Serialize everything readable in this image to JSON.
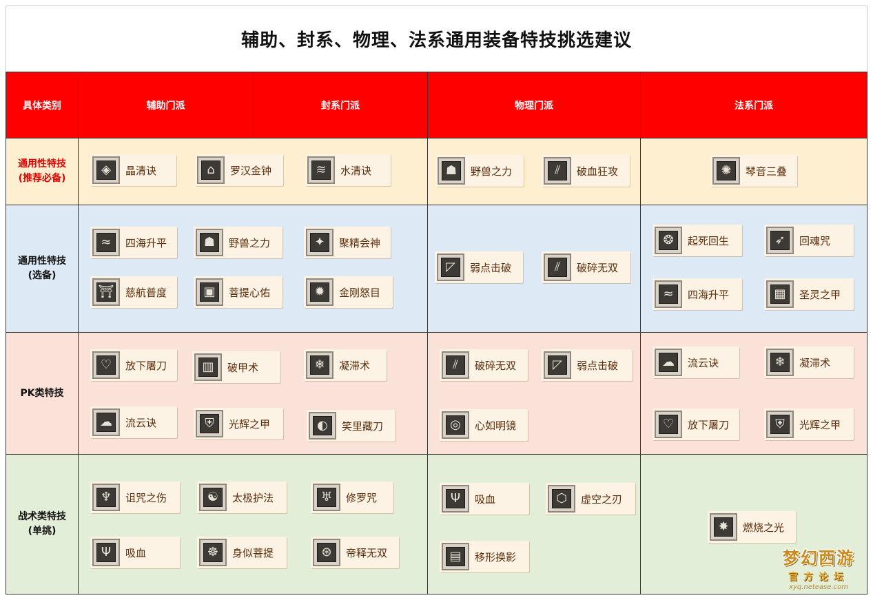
{
  "title": "辅助、封系、物理、法系通用装备特技挑选建议",
  "headers": {
    "category": "具体类别",
    "assist": "辅助门派",
    "seal": "封系门派",
    "physical": "物理门派",
    "magic": "法系门派"
  },
  "rows": {
    "common_required": {
      "label_line1": "通用性特技",
      "label_line2": "(推荐必备)"
    },
    "common_optional": {
      "label_line1": "通用性特技",
      "label_line2": "(选备)"
    },
    "pk": {
      "label_line1": "PK类特技"
    },
    "tactical": {
      "label_line1": "战术类特技",
      "label_line2": "(单挑)"
    }
  },
  "skills": {
    "r1_as": [
      "晶清诀",
      "罗汉金钟",
      "水清诀"
    ],
    "r1_ph": [
      "野兽之力",
      "破血狂攻"
    ],
    "r1_mg": [
      "琴音三叠"
    ],
    "r2_as": [
      "四海升平",
      "野兽之力",
      "聚精会神",
      "慈航普度",
      "菩提心佑",
      "金刚怒目"
    ],
    "r2_ph": [
      "弱点击破",
      "破碎无双"
    ],
    "r2_mg": [
      "起死回生",
      "回魂咒",
      "四海升平",
      "圣灵之甲"
    ],
    "r3_as": [
      "放下屠刀",
      "破甲术",
      "凝滞术",
      "流云诀",
      "光辉之甲",
      "笑里藏刀"
    ],
    "r3_ph": [
      "破碎无双",
      "弱点击破",
      "心如明镜"
    ],
    "r3_mg": [
      "流云诀",
      "凝滞术",
      "放下屠刀",
      "光辉之甲"
    ],
    "r4_as": [
      "诅咒之伤",
      "太极护法",
      "修罗咒",
      "吸血",
      "身似菩提",
      "帝释无双"
    ],
    "r4_ph": [
      "吸血",
      "虚空之刃",
      "移形换影"
    ],
    "r4_mg": [
      "燃烧之光"
    ]
  },
  "icons": {
    "r1_as": [
      "diamond-glyph-icon",
      "bell-glyph-icon",
      "water-glyph-icon"
    ],
    "r1_ph": [
      "beast-glyph-icon",
      "slash-glyph-icon"
    ],
    "r1_mg": [
      "burst-glyph-icon"
    ],
    "r2_as": [
      "wave-glyph-icon",
      "beast-glyph-icon",
      "spirit-glyph-icon",
      "temple-glyph-icon",
      "lock-glyph-icon",
      "flame-glyph-icon"
    ],
    "r2_ph": [
      "pierce-glyph-icon",
      "slash-glyph-icon"
    ],
    "r2_mg": [
      "revive-glyph-icon",
      "soul-glyph-icon",
      "wave-glyph-icon",
      "armor-glyph-icon"
    ],
    "r3_as": [
      "heart-glyph-icon",
      "grid-glyph-icon",
      "frost-glyph-icon",
      "cloud-glyph-icon",
      "shield-glyph-icon",
      "mask-glyph-icon"
    ],
    "r3_ph": [
      "slash-glyph-icon",
      "pierce-glyph-icon",
      "mirror-glyph-icon"
    ],
    "r3_mg": [
      "cloud-glyph-icon",
      "frost-glyph-icon",
      "heart-glyph-icon",
      "shield-glyph-icon"
    ],
    "r4_as": [
      "curse-glyph-icon",
      "taiji-glyph-icon",
      "demon-glyph-icon",
      "fang-glyph-icon",
      "body-glyph-icon",
      "seal-glyph-icon"
    ],
    "r4_ph": [
      "fang-glyph-icon",
      "void-glyph-icon",
      "shadow-glyph-icon"
    ],
    "r4_mg": [
      "glow-glyph-icon"
    ]
  },
  "colors": {
    "header_bg": "#ff0000",
    "row_required_bg": "#fdefd0",
    "row_optional_bg": "#dde9f4",
    "row_pk_bg": "#fbe2d9",
    "row_tactical_bg": "#e3eed8",
    "highlight_label": "#e20000"
  },
  "watermark": {
    "line1": "梦幻西游",
    "line2": "官方论坛",
    "line3": "xyq.netease.com"
  }
}
